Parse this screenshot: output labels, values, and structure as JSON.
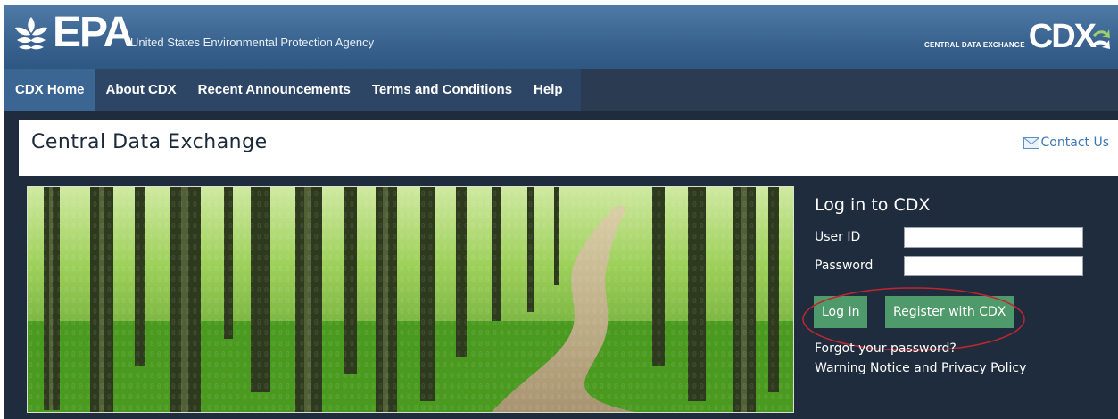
{
  "header": {
    "logo_text": "EPA",
    "agency_name": "United States Environmental Protection Agency",
    "cdx_small": "CENTRAL DATA EXCHANGE",
    "cdx_big": "CDX"
  },
  "nav": {
    "items": [
      {
        "label": "CDX Home",
        "active": true
      },
      {
        "label": "About CDX"
      },
      {
        "label": "Recent Announcements"
      },
      {
        "label": "Terms and Conditions"
      },
      {
        "label": "Help"
      }
    ]
  },
  "page": {
    "title": "Central Data Exchange",
    "contact_label": "Contact Us"
  },
  "login": {
    "title": "Log in to CDX",
    "user_id_label": "User ID",
    "user_id_value": "",
    "password_label": "Password",
    "password_value": "",
    "login_button": "Log In",
    "register_button": "Register with CDX",
    "forgot_password": "Forgot your password?",
    "privacy_policy": "Warning Notice and Privacy Policy"
  },
  "colors": {
    "banner": "#39628f",
    "nav_active": "#3b6592",
    "button_green": "#4f9a6b",
    "link_blue": "#3c77b5",
    "annotation_red": "#c0262e"
  },
  "icons": {
    "epa_logo": "epa-flower-icon",
    "cdx_arrow": "cdx-arrow-icon",
    "contact": "mail-icon"
  }
}
